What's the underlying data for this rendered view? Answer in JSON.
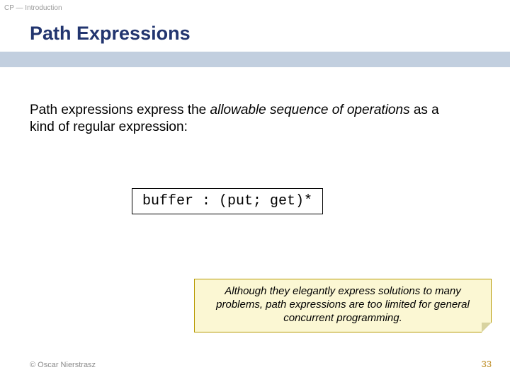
{
  "header": {
    "label": "CP — Introduction"
  },
  "title": "Path Expressions",
  "body": {
    "leading": "Path expressions express the ",
    "italic": "allowable sequence of operations",
    "trailing": " as a kind of regular expression:"
  },
  "code": "buffer : (put; get)*",
  "note": "Although they elegantly express solutions to many problems, path expressions are too limited for general concurrent programming.",
  "footer": {
    "copyright": "© Oscar Nierstrasz",
    "page": "33"
  }
}
